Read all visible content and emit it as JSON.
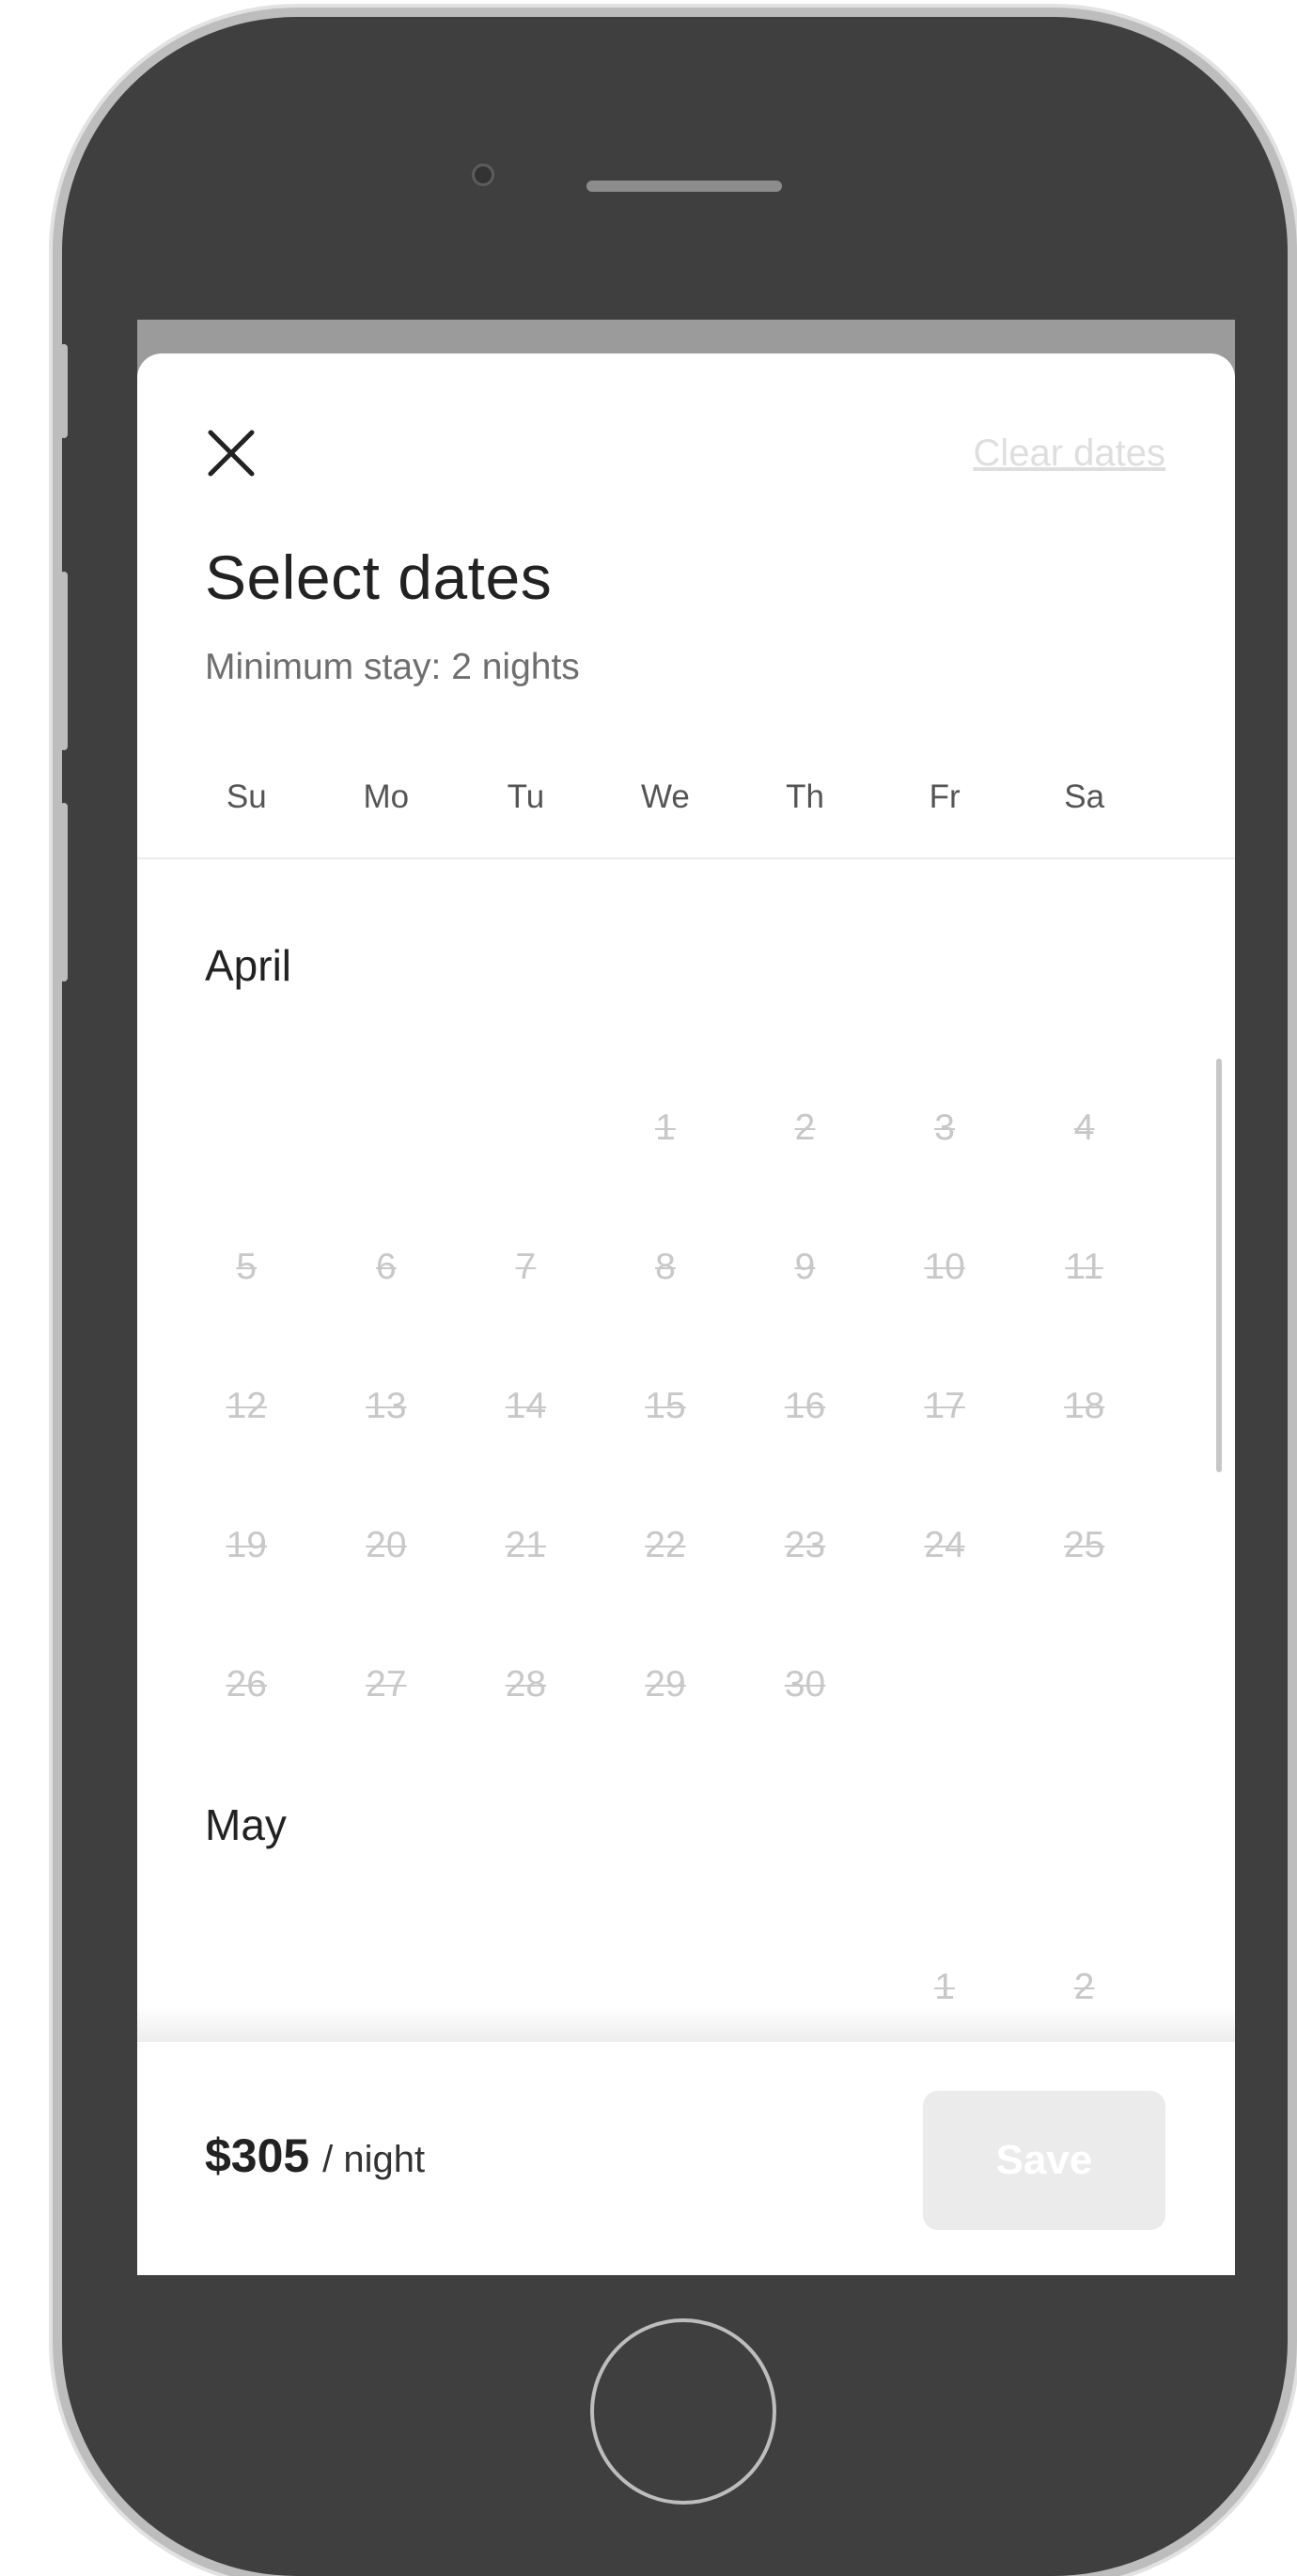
{
  "header": {
    "clear_dates": "Clear dates",
    "title": "Select dates",
    "subtitle": "Minimum stay: 2 nights"
  },
  "weekdays": [
    "Su",
    "Mo",
    "Tu",
    "We",
    "Th",
    "Fr",
    "Sa"
  ],
  "months": [
    {
      "name": "April",
      "weeks": [
        [
          "",
          "",
          "",
          "1",
          "2",
          "3",
          "4"
        ],
        [
          "5",
          "6",
          "7",
          "8",
          "9",
          "10",
          "11"
        ],
        [
          "12",
          "13",
          "14",
          "15",
          "16",
          "17",
          "18"
        ],
        [
          "19",
          "20",
          "21",
          "22",
          "23",
          "24",
          "25"
        ],
        [
          "26",
          "27",
          "28",
          "29",
          "30",
          "",
          ""
        ]
      ]
    },
    {
      "name": "May",
      "weeks": [
        [
          "",
          "",
          "",
          "",
          "",
          "1",
          "2"
        ]
      ]
    }
  ],
  "footer": {
    "price": "$305",
    "per_night": "/ night",
    "save_label": "Save"
  },
  "colors": {
    "phone_body": "#3f3f3f",
    "unavailable_day": "#c8c8c8",
    "disabled_button": "#ebebeb"
  },
  "icons": {
    "close": "close-icon"
  }
}
